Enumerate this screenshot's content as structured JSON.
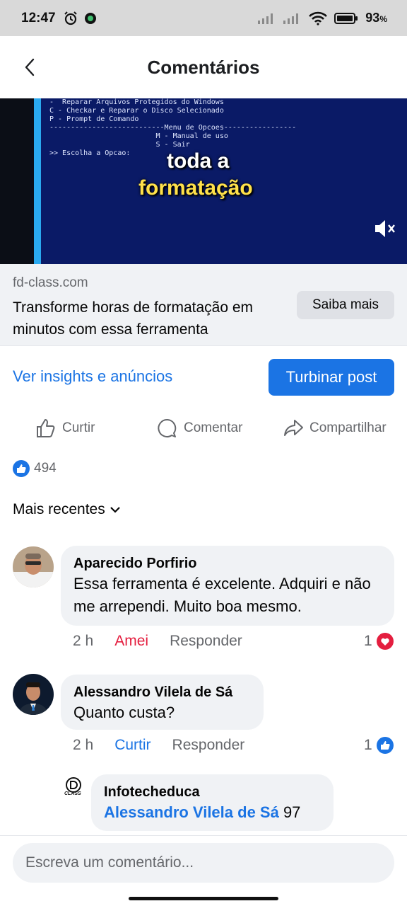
{
  "status_bar": {
    "time": "12:47",
    "battery": "93",
    "battery_unit": "%"
  },
  "header": {
    "title": "Comentários"
  },
  "video": {
    "terminal_lines": [
      "-  Reparar Arquivos Protegidos do Windows",
      "C - Checkar e Reparar o Disco Selecionado",
      "P - Prompt de Comando",
      "",
      "---------------------------Menu de Opcoes-----------------",
      "",
      "                         M - Manual de uso",
      "",
      "                         S - Sair",
      "",
      ">> Escolha a Opcao:"
    ],
    "caption_line1": "toda a",
    "caption_line2": "formatação"
  },
  "link_preview": {
    "domain": "fd-class.com",
    "headline": "Transforme horas de formatação em minutos com essa ferramenta",
    "cta": "Saiba mais"
  },
  "insights_link": "Ver insights e anúncios",
  "boost_button": "Turbinar post",
  "actions": {
    "like": "Curtir",
    "comment": "Comentar",
    "share": "Compartilhar"
  },
  "reactions_count": "494",
  "sort_label": "Mais recentes",
  "comments": [
    {
      "author": "Aparecido Porfirio",
      "text": "Essa ferramenta é excelente. Adquiri e não me arrependi. Muito boa mesmo.",
      "time": "2 h",
      "reaction_action": "Amei",
      "reply": "Responder",
      "reaction_count": "1"
    },
    {
      "author": "Alessandro Vilela de Sá",
      "text": "Quanto custa?",
      "time": "2 h",
      "reaction_action": "Curtir",
      "reply": "Responder",
      "reaction_count": "1"
    },
    {
      "author": "Infotecheduca",
      "mention": "Alessandro Vilela de Sá",
      "text": " 97",
      "logo_text": "CLASS"
    }
  ],
  "composer_placeholder": "Escreva um comentário...",
  "colors": {
    "accent": "#1b74e4",
    "love": "#e41e3f",
    "bubble": "#f0f2f5"
  }
}
